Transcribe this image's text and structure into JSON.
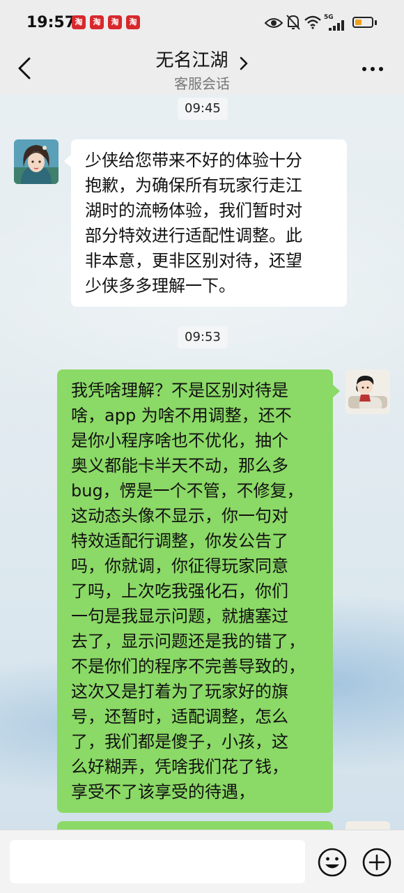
{
  "status_bar": {
    "time": "19:57",
    "app_badges": [
      "app-notification-badge",
      "app-notification-badge",
      "app-notification-badge",
      "app-notification-badge"
    ],
    "network": "5G",
    "battery_color": "#f0a020"
  },
  "header": {
    "title": "无名江湖",
    "subtitle": "客服会话",
    "icons": [
      "back-arrow-icon",
      "chevron-right-icon",
      "more-dots-icon"
    ]
  },
  "messages": [
    {
      "type": "timestamp",
      "text": "09:45"
    },
    {
      "type": "incoming",
      "avatar": "customer-service-avatar",
      "text": "少侠给您带来不好的体验十分\n抱歉，为确保所有玩家行走江\n湖时的流畅体验，我们暂时对\n部分特效进行适配性调整。此\n非本意，更非区别对待，还望\n少侠多多理解一下。"
    },
    {
      "type": "timestamp",
      "text": "09:53"
    },
    {
      "type": "outgoing",
      "avatar": "user-avatar",
      "text": "我凭啥理解？不是区别对待是\n啥，app 为啥不用调整，还不\n是你小程序啥也不优化，抽个\n奥义都能卡半天不动，那么多\nbug，愣是一个不管，不修复，\n这动态头像不显示，你一句对\n特效适配行调整，你发公告了\n吗，你就调，你征得玩家同意\n了吗，上次吃我强化石，你们\n一句是我显示问题，就搪塞过\n去了，显示问题还是我的错了，\n不是你们的程序不完善导致的，\n这次又是打着为了玩家好的旗\n号，还暂时，适配调整，怎么\n了，我们都是傻子，小孩，这\n么好糊弄，凭啥我们花了钱，\n享受不了该享受的待遇，"
    }
  ],
  "colors": {
    "outgoing_bubble": "#8bd966",
    "incoming_bubble": "#ffffff",
    "header_bg": "#ededed"
  },
  "input_bar": {
    "value": "",
    "icons": [
      "emoji-icon",
      "add-plus-icon"
    ]
  }
}
